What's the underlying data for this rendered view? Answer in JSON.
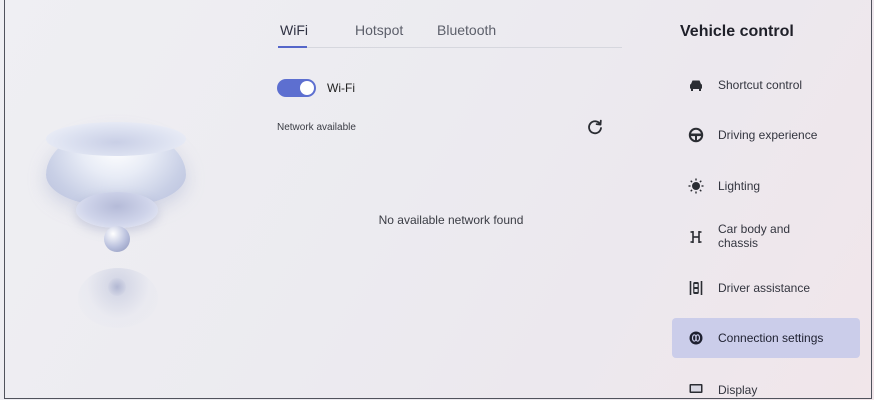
{
  "tabs": [
    {
      "label": "WiFi",
      "active": true
    },
    {
      "label": "Hotspot",
      "active": false
    },
    {
      "label": "Bluetooth",
      "active": false
    }
  ],
  "wifi": {
    "toggle_label": "Wi-Fi",
    "enabled": true,
    "network_section_label": "Network available",
    "empty_message": "No available network found"
  },
  "menu": {
    "title": "Vehicle control",
    "items": [
      {
        "label": "Shortcut control",
        "icon": "car-icon"
      },
      {
        "label": "Driving experience",
        "icon": "steering-wheel-icon"
      },
      {
        "label": "Lighting",
        "icon": "bulb-icon"
      },
      {
        "label": "Car body and chassis",
        "icon": "chassis-icon"
      },
      {
        "label": "Driver assistance",
        "icon": "driver-assist-icon"
      },
      {
        "label": "Connection settings",
        "icon": "connection-icon",
        "selected": true
      },
      {
        "label": "Display",
        "icon": "display-icon"
      }
    ]
  },
  "colors": {
    "accent": "#5d6fd0",
    "selected_bg": "#cbcdea"
  }
}
